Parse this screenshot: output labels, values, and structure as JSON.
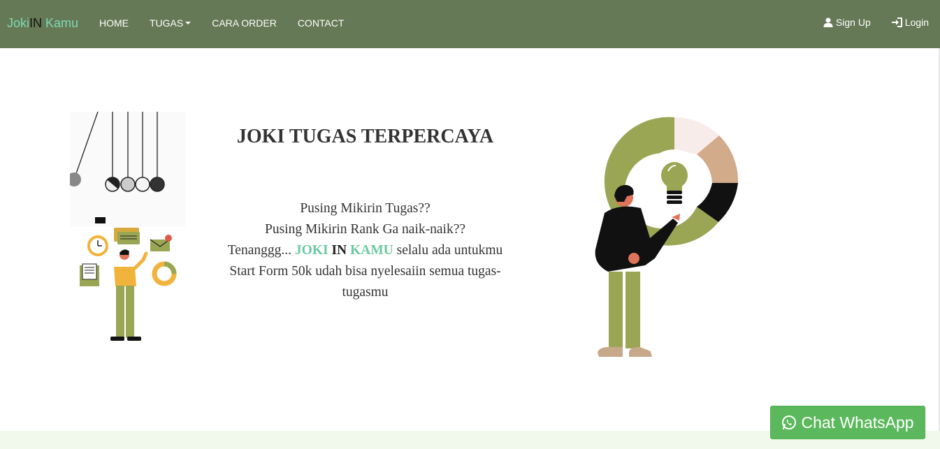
{
  "brand": {
    "part1": "Joki",
    "part2": "IN",
    "part3": " Kamu"
  },
  "nav": {
    "home": "HOME",
    "tugas": "TUGAS",
    "cara_order": "CARA ORDER",
    "contact": "CONTACT",
    "sign_up": "Sign Up",
    "login": "Login"
  },
  "hero": {
    "title": "JOKI TUGAS TERPERCAYA",
    "line1": "Pusing Mikirin Tugas??",
    "line2": "Pusing Mikirin Rank Ga naik-naik??",
    "line3_prefix": "Tenanggg... ",
    "line3_joki": "JOKI",
    "line3_in": "IN",
    "line3_kamu": "KAMU",
    "line3_suffix": " selalu ada untukmu",
    "line4": "Start Form 50k udah bisa nyelesaiin semua tugas-tugasmu"
  },
  "whatsapp": {
    "label": "Chat WhatsApp"
  },
  "colors": {
    "navbar": "#667956",
    "brand_accent": "#7ed8b6",
    "highlight": "#6bc9a3",
    "whatsapp": "#5cb85c",
    "illustration_green": "#9ba654"
  },
  "icons": [
    "user-icon",
    "login-icon",
    "whatsapp-icon",
    "caret-down-icon"
  ]
}
